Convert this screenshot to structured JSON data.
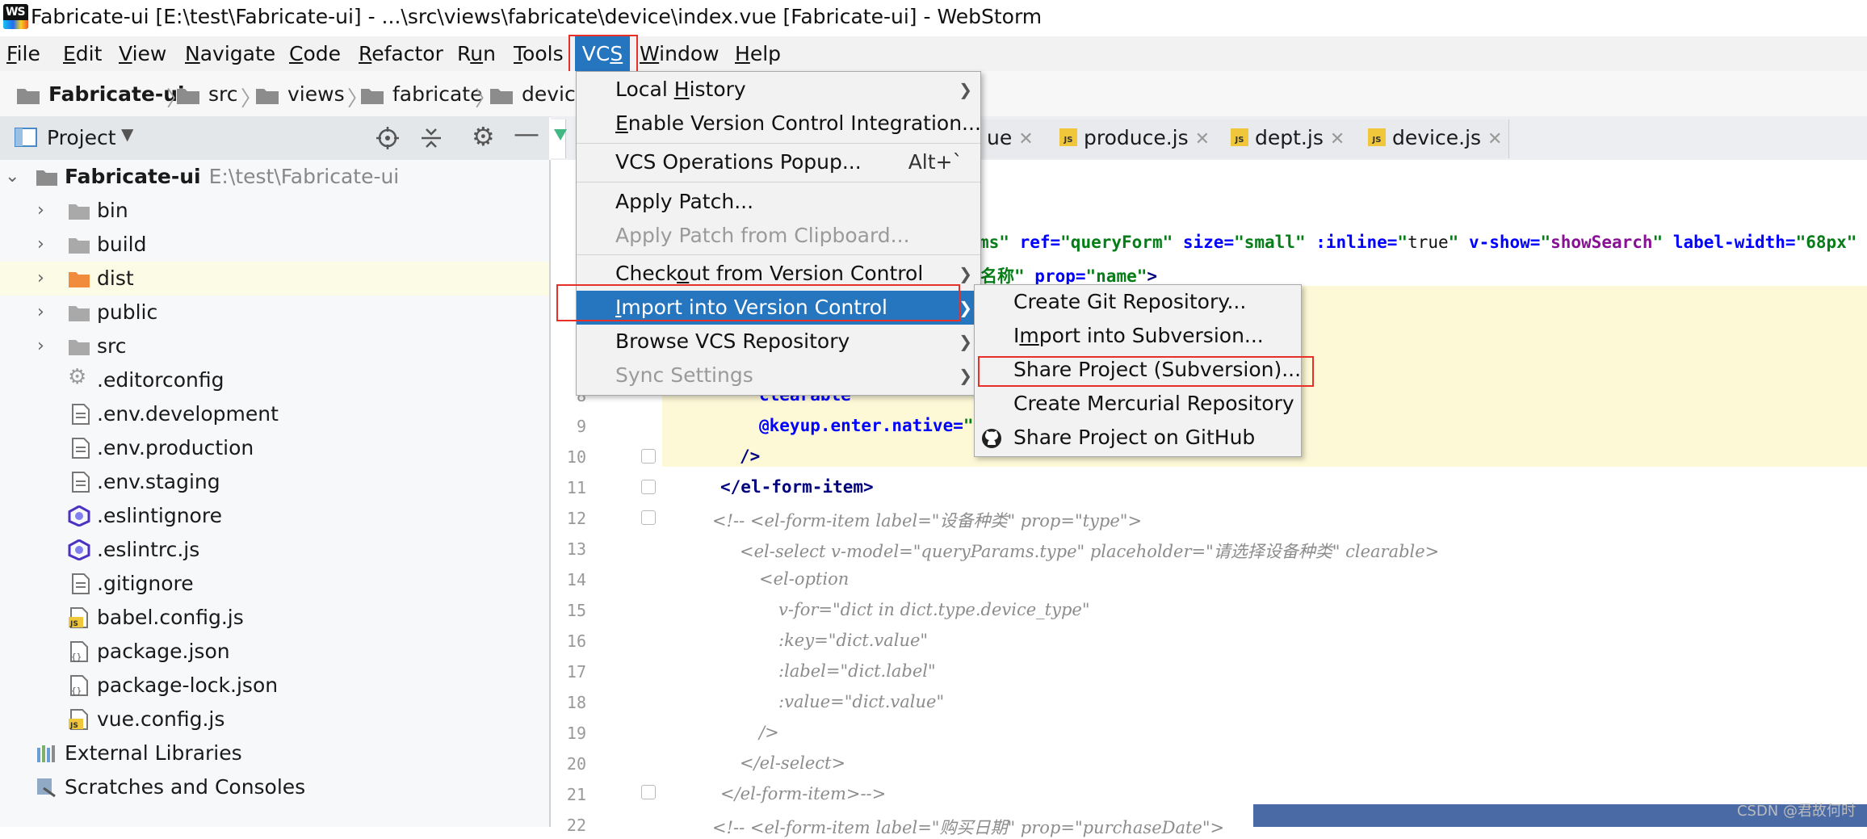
{
  "window": {
    "title": "Fabricate-ui [E:\\test\\Fabricate-ui] - ...\\src\\views\\fabricate\\device\\index.vue [Fabricate-ui] - WebStorm",
    "app_icon_text": "WS"
  },
  "menubar": {
    "items": [
      {
        "pre": "",
        "mn": "F",
        "post": "ile"
      },
      {
        "pre": "",
        "mn": "E",
        "post": "dit"
      },
      {
        "pre": "",
        "mn": "V",
        "post": "iew"
      },
      {
        "pre": "",
        "mn": "N",
        "post": "avigate"
      },
      {
        "pre": "",
        "mn": "C",
        "post": "ode"
      },
      {
        "pre": "",
        "mn": "R",
        "post": "efactor"
      },
      {
        "pre": "R",
        "mn": "u",
        "post": "n"
      },
      {
        "pre": "",
        "mn": "T",
        "post": "ools"
      },
      {
        "pre": "VC",
        "mn": "S",
        "post": ""
      },
      {
        "pre": "",
        "mn": "W",
        "post": "indow"
      },
      {
        "pre": "",
        "mn": "H",
        "post": "elp"
      }
    ],
    "active": "VCS"
  },
  "breadcrumb": [
    "Fabricate-ui",
    "src",
    "views",
    "fabricate",
    "device"
  ],
  "project_panel": {
    "title": "Project",
    "root": {
      "name": "Fabricate-ui",
      "path": "E:\\test\\Fabricate-ui"
    },
    "items": [
      {
        "name": "bin",
        "type": "folder"
      },
      {
        "name": "build",
        "type": "folder"
      },
      {
        "name": "dist",
        "type": "folder-orange"
      },
      {
        "name": "public",
        "type": "folder"
      },
      {
        "name": "src",
        "type": "folder"
      },
      {
        "name": ".editorconfig",
        "type": "gear"
      },
      {
        "name": ".env.development",
        "type": "file"
      },
      {
        "name": ".env.production",
        "type": "file"
      },
      {
        "name": ".env.staging",
        "type": "file"
      },
      {
        "name": ".eslintignore",
        "type": "eslint"
      },
      {
        "name": ".eslintrc.js",
        "type": "eslint"
      },
      {
        "name": ".gitignore",
        "type": "file"
      },
      {
        "name": "babel.config.js",
        "type": "js"
      },
      {
        "name": "package.json",
        "type": "json"
      },
      {
        "name": "package-lock.json",
        "type": "json"
      },
      {
        "name": "vue.config.js",
        "type": "js"
      },
      {
        "name": "External Libraries",
        "type": "libs"
      },
      {
        "name": "Scratches and Consoles",
        "type": "scratch"
      }
    ]
  },
  "editor": {
    "tabs": [
      {
        "name": "ue"
      },
      {
        "name": "produce.js"
      },
      {
        "name": "dept.js"
      },
      {
        "name": "device.js"
      }
    ],
    "line_numbers": [
      "8",
      "9",
      "10",
      "11",
      "12",
      "13",
      "14",
      "15",
      "16",
      "17",
      "18",
      "19",
      "20",
      "21",
      "22"
    ],
    "code": {
      "l_form_rest": [
        "ms\"",
        " ref=",
        "\"queryForm\"",
        " size=",
        "\"small\"",
        " :inline=",
        "\"",
        "true",
        "\"",
        " v-show=",
        "\"",
        "showSearch",
        "\"",
        " label-width=",
        "\"68px\""
      ],
      "l_item_label": [
        "名称\"",
        " prop=",
        "\"name\"",
        ">"
      ],
      "l8": "clearable",
      "l9": [
        "@keyup.enter.native=",
        "\""
      ],
      "l10": "/>",
      "l11": [
        "</",
        "el-form-item",
        ">"
      ],
      "l12": "<!-- <el-form-item label=\"设备种类\" prop=\"type\">",
      "l13": "<el-select v-model=\"queryParams.type\" placeholder=\"请选择设备种类\" clearable>",
      "l14": "<el-option",
      "l15": "v-for=\"dict in dict.type.device_type\"",
      "l16": ":key=\"dict.value\"",
      "l17": ":label=\"dict.label\"",
      "l18": ":value=\"dict.value\"",
      "l19": "/>",
      "l20": "</el-select>",
      "l21": "</el-form-item>-->",
      "l22": "<!-- <el-form-item label=\"购买日期\" prop=\"purchaseDate\">"
    }
  },
  "vcs_menu": {
    "items": [
      {
        "pre": "Local ",
        "mn": "H",
        "post": "istory",
        "submenu": true
      },
      {
        "pre": "",
        "mn": "E",
        "post": "nable Version Control Integration...",
        "submenu": false
      },
      {
        "sep": true
      },
      {
        "pre": "VCS Operations Popup...",
        "mn": "",
        "post": "",
        "shortcut": "Alt+`",
        "submenu": false
      },
      {
        "sep": true
      },
      {
        "pre": "Apply Patch...",
        "mn": "",
        "post": "",
        "submenu": false
      },
      {
        "pre": "Apply Patch from Clipboard...",
        "mn": "",
        "post": "",
        "submenu": false,
        "disabled": true
      },
      {
        "sep": true
      },
      {
        "pre": "Check",
        "mn": "o",
        "post": "ut from Version Control",
        "submenu": true
      },
      {
        "pre": "",
        "mn": "I",
        "post": "mport into Version Control",
        "submenu": true,
        "active": true
      },
      {
        "pre": "Browse VCS Repository",
        "mn": "",
        "post": "",
        "submenu": true
      },
      {
        "pre": "Sync Settings",
        "mn": "",
        "post": "",
        "submenu": true,
        "disabled": true
      }
    ]
  },
  "import_submenu": {
    "items": [
      {
        "pre": "Create Git Repository...",
        "mn": "",
        "post": ""
      },
      {
        "pre": "I",
        "mn": "m",
        "post": "port into Subversion..."
      },
      {
        "pre": "Share Project (Subversion)...",
        "mn": "",
        "post": ""
      },
      {
        "pre": "Create Mercurial Repository",
        "mn": "",
        "post": ""
      },
      {
        "pre": "Share Project on GitHub",
        "mn": "",
        "post": "",
        "icon": "github-icon"
      }
    ]
  },
  "watermark": "CSDN @君故何时",
  "colors": {
    "selection": "#2675bf",
    "highlight_box": "#e8302a",
    "current_line": "#fdf8d6",
    "js_badge": "#f0c63a",
    "eslint": "#4b32c3"
  }
}
